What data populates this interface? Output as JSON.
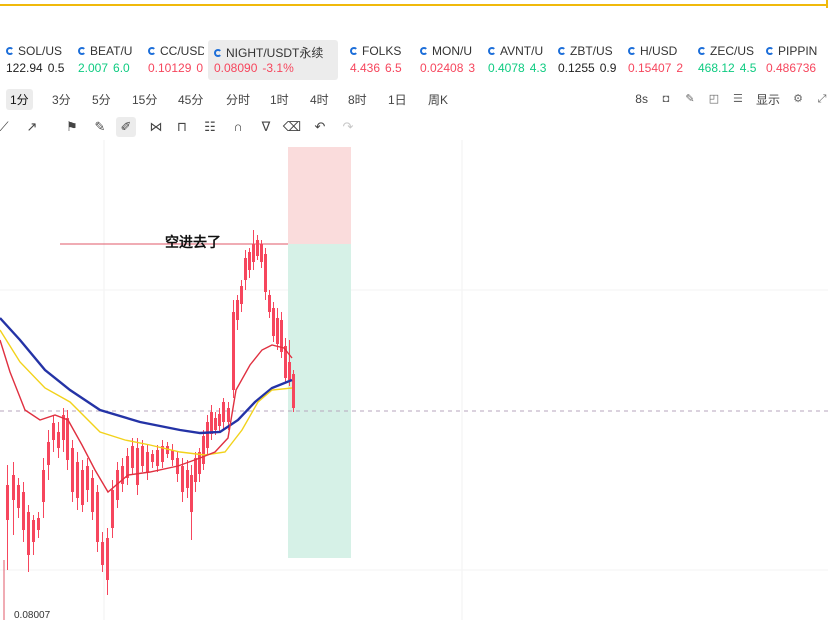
{
  "tickers": [
    {
      "symbol": "SOL/US",
      "value": "122.94",
      "change": "0.5",
      "trend": "neutral"
    },
    {
      "symbol": "BEAT/U",
      "value": "2.007",
      "change": "6.0",
      "trend": "up"
    },
    {
      "symbol": "CC/USD",
      "value": "0.10129",
      "change": "0",
      "trend": "down"
    },
    {
      "symbol": "NIGHT/USDT永续",
      "value": "0.08090",
      "change": "-3.1%",
      "trend": "down",
      "active": true
    },
    {
      "symbol": "FOLKS",
      "value": "4.436",
      "change": "6.5",
      "trend": "down"
    },
    {
      "symbol": "MON/U",
      "value": "0.02408",
      "change": "3",
      "trend": "down"
    },
    {
      "symbol": "AVNT/U",
      "value": "0.4078",
      "change": "4.3",
      "trend": "up"
    },
    {
      "symbol": "ZBT/US",
      "value": "0.1255",
      "change": "0.9",
      "trend": "neutral"
    },
    {
      "symbol": "H/USD",
      "value": "0.15407",
      "change": "2",
      "trend": "down"
    },
    {
      "symbol": "ZEC/US",
      "value": "468.12",
      "change": "4.5",
      "trend": "up"
    },
    {
      "symbol": "PIPPIN",
      "value": "0.486736",
      "change": "",
      "trend": "down"
    }
  ],
  "intervals": [
    "1分",
    "3分",
    "5分",
    "15分",
    "45分",
    "分时",
    "1时",
    "4时",
    "8时",
    "1日",
    "周K"
  ],
  "active_interval": "1分",
  "toolbar_right": {
    "countdown": "8s",
    "display_label": "显示"
  },
  "drawing_tools": [
    {
      "name": "trend-line-icon",
      "glyph": "⟋"
    },
    {
      "name": "ray-icon",
      "glyph": "↗"
    },
    {
      "name": "flag-icon",
      "glyph": "⚑"
    },
    {
      "name": "ruler-icon",
      "glyph": "✎"
    },
    {
      "name": "brush-icon",
      "glyph": "✐",
      "active": true
    },
    {
      "name": "pattern-icon",
      "glyph": "⋈"
    },
    {
      "name": "lock-icon",
      "glyph": "⊓"
    },
    {
      "name": "note-icon",
      "glyph": "☷"
    },
    {
      "name": "magnet-icon",
      "glyph": "∩"
    },
    {
      "name": "filter-icon",
      "glyph": "∇"
    },
    {
      "name": "trash-icon",
      "glyph": "⌫"
    },
    {
      "name": "undo-icon",
      "glyph": "↶"
    },
    {
      "name": "redo-icon",
      "glyph": "↷",
      "muted": true
    }
  ],
  "annotation": {
    "text": "空进去了"
  },
  "price_label": "0.08007",
  "colors": {
    "up": "#0ecb81",
    "down": "#f6465d",
    "ma_fast": "#e03040",
    "ma_mid": "#f2d21b",
    "ma_slow": "#2433a6",
    "stop_zone": "#fadcdc",
    "target_zone": "#d6f1e7"
  }
}
